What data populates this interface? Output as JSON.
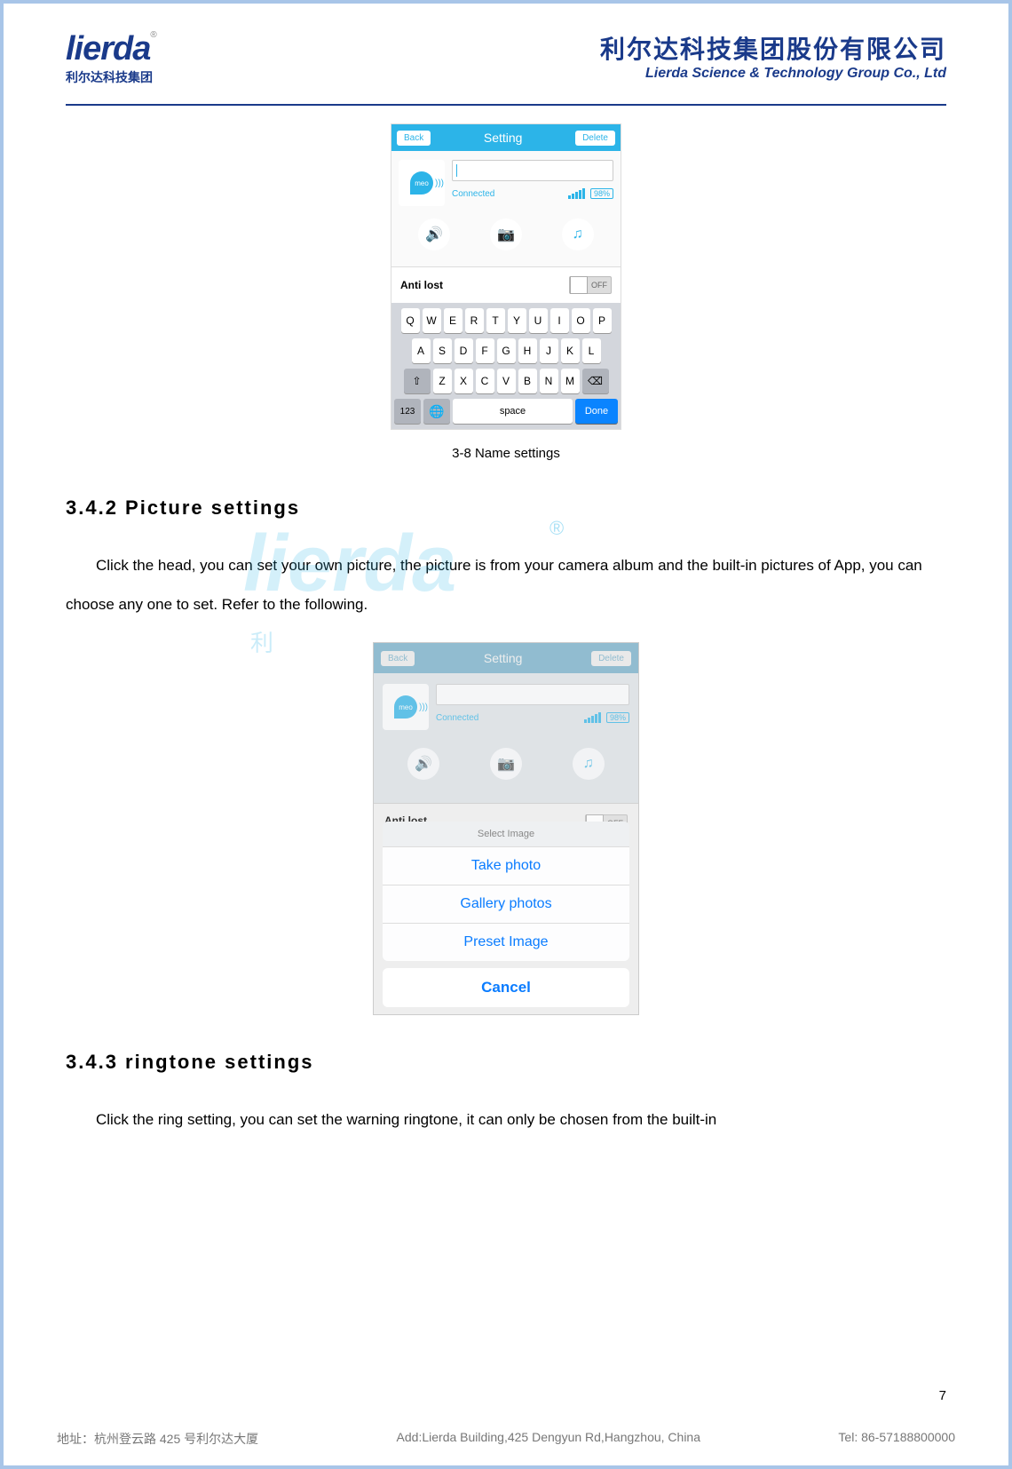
{
  "header": {
    "logo_text": "lierda",
    "logo_sub": "利尔达科技集团",
    "tm": "®",
    "company_cn": "利尔达科技集团股份有限公司",
    "company_en": "Lierda Science & Technology Group Co., Ltd"
  },
  "screenshot1": {
    "back": "Back",
    "title": "Setting",
    "delete": "Delete",
    "avatar": "meo",
    "connected": "Connected",
    "battery": "98%",
    "anti_lost": "Anti lost",
    "toggle": "OFF",
    "keyboard": {
      "row1": [
        "Q",
        "W",
        "E",
        "R",
        "T",
        "Y",
        "U",
        "I",
        "O",
        "P"
      ],
      "row2": [
        "A",
        "S",
        "D",
        "F",
        "G",
        "H",
        "J",
        "K",
        "L"
      ],
      "row3_shift": "⇧",
      "row3": [
        "Z",
        "X",
        "C",
        "V",
        "B",
        "N",
        "M"
      ],
      "row3_del": "⌫",
      "k123": "123",
      "globe": "🌐",
      "space": "space",
      "done": "Done"
    }
  },
  "caption1": "3-8   Name settings",
  "section1_title": "3.4.2 Picture settings",
  "section1_body": "Click the head, you can set your own picture, the picture is from your camera album and the built-in pictures of App, you can choose any one to set. Refer to the following.",
  "watermark": "lierda",
  "watermark_r": "®",
  "watermark_sub": "利",
  "screenshot2": {
    "back": "Back",
    "title": "Setting",
    "delete": "Delete",
    "avatar": "meo",
    "connected": "Connected",
    "battery": "98%",
    "anti_lost": "Anti lost",
    "toggle": "OFF",
    "sheet_title": "Select Image",
    "opt1": "Take photo",
    "opt2": "Gallery photos",
    "opt3": "Preset Image",
    "cancel": "Cancel"
  },
  "section2_title": "3.4.3 ringtone settings",
  "section2_body": "Click the ring setting, you can set the warning ringtone, it can only be chosen from the built-in",
  "page_num": "7",
  "footer": {
    "addr_cn": "地址：杭州登云路 425 号利尔达大厦",
    "addr_en": "Add:Lierda Building,425 Dengyun Rd,Hangzhou, China",
    "tel": "Tel: 86-57188800000"
  }
}
